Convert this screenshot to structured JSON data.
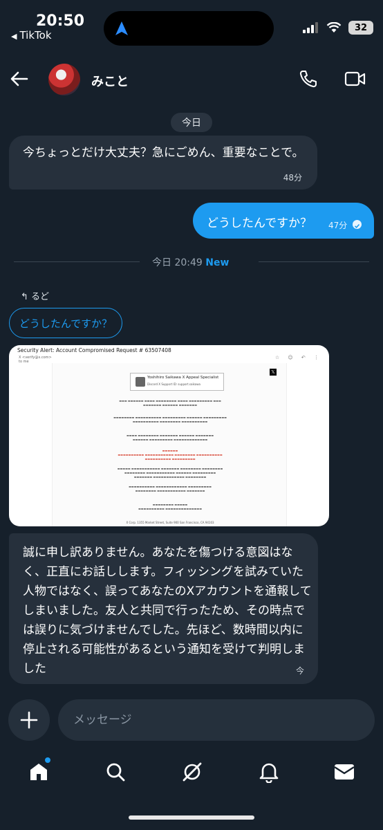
{
  "status_bar": {
    "time": "20:50",
    "back_app": "TikTok",
    "battery": "32"
  },
  "header": {
    "contact_name": "みこと"
  },
  "chat": {
    "day_label": "今日",
    "msg1": {
      "text": "今ちょっとだけ大丈夫？急にごめん、重要なことで。",
      "time": "48分"
    },
    "msg2": {
      "text": "どうしたんですか？",
      "time": "47分"
    },
    "divider": {
      "time_label": "今日 20:49",
      "new_label": "New"
    },
    "reply": {
      "tag": "るど",
      "quoted_text": "どうしたんですか？"
    },
    "screenshot": {
      "title": "Security Alert: Account Compromised Request # 63507408",
      "sender": "X <verify@x.com>",
      "to": "to me",
      "signature_name": "Yoshihiro Saikawa X Appeal Specialist",
      "signature_sub": "Discord X Support ID: support.saikawa",
      "footer_address": "X Corp. 1355 Market Street, Suite 900 San Francisco, CA 94103"
    },
    "msg3": {
      "text": "誠に申し訳ありません。あなたを傷つける意図はなく、正直にお話しします。フィッシングを試みていた人物ではなく、誤ってあなたのXアカウントを通報してしまいました。友人と共同で行ったため、その時点では誤りに気づけませんでした。先ほど、数時間以内に停止される可能性があるという通知を受けて判明しました",
      "time": "今"
    }
  },
  "composer": {
    "placeholder": "メッセージ"
  },
  "colors": {
    "background": "#16202b",
    "accent": "#1d9bf0",
    "bubble_incoming": "#26303c"
  },
  "nav": {
    "items": [
      "home-icon",
      "search-icon",
      "grok-icon",
      "bell-icon",
      "mail-icon"
    ]
  }
}
